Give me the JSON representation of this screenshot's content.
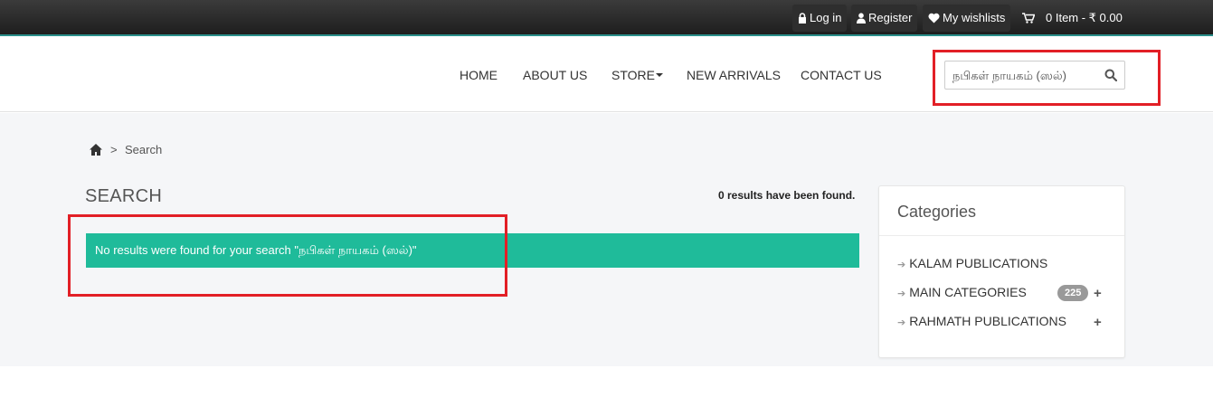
{
  "topbar": {
    "login": "Log in",
    "register": "Register",
    "wishlist": "My wishlists",
    "cart": "0 Item - ₹ 0.00"
  },
  "nav": {
    "home": "HOME",
    "about": "ABOUT US",
    "store": "STORE",
    "new_arrivals": "NEW ARRIVALS",
    "contact": "CONTACT US"
  },
  "search": {
    "value": "நபிகள் நாயகம் (ஸல்)"
  },
  "breadcrumb": {
    "separator": ">",
    "current": "Search"
  },
  "main": {
    "title": "SEARCH",
    "results_count": "0 results have been found.",
    "alert": "No results were found for your search \"நபிகள் நாயகம் (ஸல்)\""
  },
  "sidebar": {
    "title": "Categories",
    "items": [
      {
        "label": "KALAM PUBLICATIONS",
        "badge": "",
        "expandable": false
      },
      {
        "label": "MAIN CATEGORIES",
        "badge": "225",
        "expandable": true
      },
      {
        "label": "RAHMATH PUBLICATIONS",
        "badge": "",
        "expandable": true
      }
    ],
    "expand_symbol": "+",
    "arrow_symbol": "➔"
  },
  "colors": {
    "alert_bg": "#1fbb9a",
    "highlight": "#e21f26",
    "topbar": "#2b2b2b"
  }
}
